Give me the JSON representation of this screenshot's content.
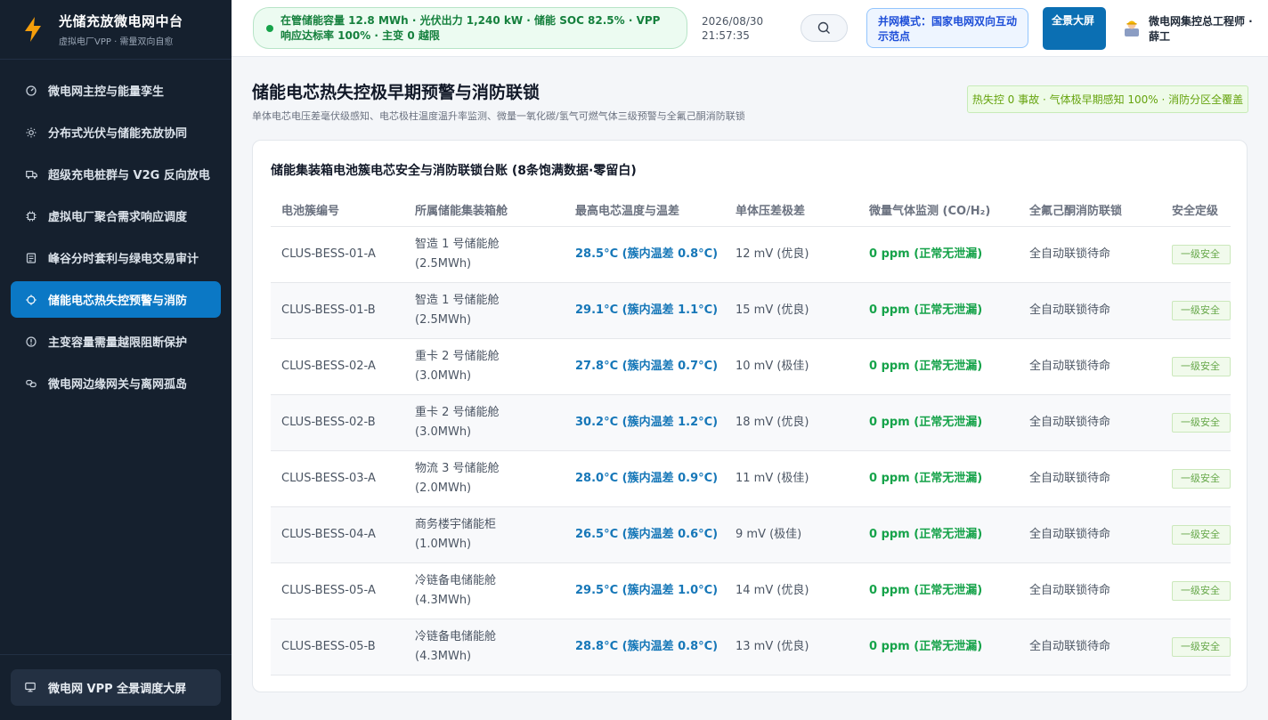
{
  "brand": {
    "title": "光储充放微电网中台",
    "subtitle": "虚拟电厂VPP · 需量双向自愈"
  },
  "sidebar": {
    "items": [
      {
        "label": "微电网主控与能量孪生",
        "icon": "gauge-icon"
      },
      {
        "label": "分布式光伏与储能充放协同",
        "icon": "sun-icon"
      },
      {
        "label": "超级充电桩群与 V2G 反向放电",
        "icon": "truck-icon"
      },
      {
        "label": "虚拟电厂聚合需求响应调度",
        "icon": "chip-icon"
      },
      {
        "label": "峰谷分时套利与绿电交易审计",
        "icon": "document-icon"
      },
      {
        "label": "储能电芯热失控预警与消防",
        "icon": "shield-icon",
        "active": true
      },
      {
        "label": "主变容量需量越限阻断保护",
        "icon": "alert-circle-icon"
      },
      {
        "label": "微电网边缘网关与离网孤岛",
        "icon": "link-icon"
      }
    ],
    "footer_label": "微电网 VPP 全景调度大屏"
  },
  "header": {
    "status_text": "在管储能容量 12.8 MWh · 光伏出力 1,240 kW · 储能 SOC 82.5% · VPP 响应达标率 100% · 主变 0 越限",
    "date": "2026/08/30",
    "time": "21:57:35",
    "grid_mode": "并网模式：国家电网双向互动示范点",
    "screen_button": "全景大屏",
    "user_name": "微电网集控总工程师 · 薛工"
  },
  "page": {
    "title": "储能电芯热失控极早期预警与消防联锁",
    "subtitle": "单体电芯电压差毫伏级感知、电芯极柱温度温升率监测、微量一氧化碳/氢气可燃气体三级预警与全氟己酮消防联锁",
    "badge": "热失控 0 事故 · 气体极早期感知 100% · 消防分区全覆盖"
  },
  "table": {
    "title": "储能集装箱电池簇电芯安全与消防联锁台账 (8条饱满数据·零留白)",
    "columns": [
      "电池簇编号",
      "所属储能集装箱舱",
      "最高电芯温度与温差",
      "单体压差极差",
      "微量气体监测 (CO/H₂)",
      "全氟己酮消防联锁",
      "安全定级"
    ],
    "rows": [
      {
        "id": "CLUS-BESS-01-A",
        "cabin": "智造 1 号储能舱",
        "capacity": "(2.5MWh)",
        "temp": "28.5°C (簇内温差 0.8°C)",
        "voltage": "12 mV (优良)",
        "gas": "0 ppm (正常无泄漏)",
        "fire": "全自动联锁待命",
        "level": "一级安全"
      },
      {
        "id": "CLUS-BESS-01-B",
        "cabin": "智造 1 号储能舱",
        "capacity": "(2.5MWh)",
        "temp": "29.1°C (簇内温差 1.1°C)",
        "voltage": "15 mV (优良)",
        "gas": "0 ppm (正常无泄漏)",
        "fire": "全自动联锁待命",
        "level": "一级安全"
      },
      {
        "id": "CLUS-BESS-02-A",
        "cabin": "重卡 2 号储能舱",
        "capacity": "(3.0MWh)",
        "temp": "27.8°C (簇内温差 0.7°C)",
        "voltage": "10 mV (极佳)",
        "gas": "0 ppm (正常无泄漏)",
        "fire": "全自动联锁待命",
        "level": "一级安全"
      },
      {
        "id": "CLUS-BESS-02-B",
        "cabin": "重卡 2 号储能舱",
        "capacity": "(3.0MWh)",
        "temp": "30.2°C (簇内温差 1.2°C)",
        "voltage": "18 mV (优良)",
        "gas": "0 ppm (正常无泄漏)",
        "fire": "全自动联锁待命",
        "level": "一级安全"
      },
      {
        "id": "CLUS-BESS-03-A",
        "cabin": "物流 3 号储能舱",
        "capacity": "(2.0MWh)",
        "temp": "28.0°C (簇内温差 0.9°C)",
        "voltage": "11 mV (极佳)",
        "gas": "0 ppm (正常无泄漏)",
        "fire": "全自动联锁待命",
        "level": "一级安全"
      },
      {
        "id": "CLUS-BESS-04-A",
        "cabin": "商务楼宇储能柜",
        "capacity": "(1.0MWh)",
        "temp": "26.5°C (簇内温差 0.6°C)",
        "voltage": "9 mV (极佳)",
        "gas": "0 ppm (正常无泄漏)",
        "fire": "全自动联锁待命",
        "level": "一级安全"
      },
      {
        "id": "CLUS-BESS-05-A",
        "cabin": "冷链备电储能舱",
        "capacity": "(4.3MWh)",
        "temp": "29.5°C (簇内温差 1.0°C)",
        "voltage": "14 mV (优良)",
        "gas": "0 ppm (正常无泄漏)",
        "fire": "全自动联锁待命",
        "level": "一级安全"
      },
      {
        "id": "CLUS-BESS-05-B",
        "cabin": "冷链备电储能舱",
        "capacity": "(4.3MWh)",
        "temp": "28.8°C (簇内温差 0.8°C)",
        "voltage": "13 mV (优良)",
        "gas": "0 ppm (正常无泄漏)",
        "fire": "全自动联锁待命",
        "level": "一级安全"
      }
    ]
  },
  "colors": {
    "sidebar_bg": "#15202e",
    "accent": "#0b78c5",
    "temp_text": "#1677b8",
    "gas_text": "#16a34a"
  }
}
